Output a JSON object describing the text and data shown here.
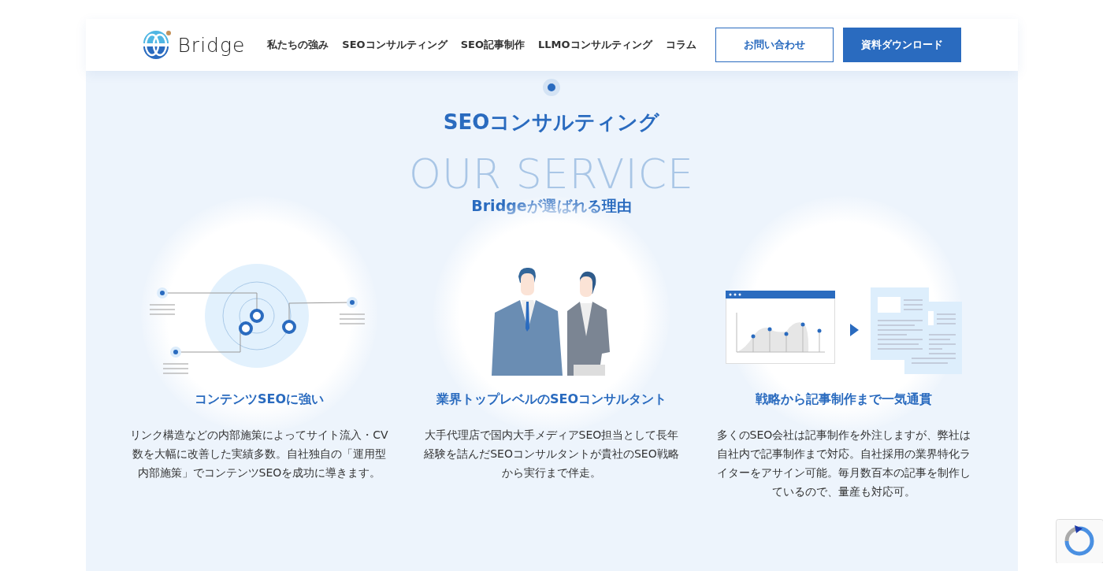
{
  "header": {
    "logo_text": "Bridge",
    "nav": [
      {
        "label": "私たちの強み"
      },
      {
        "label": "SEOコンサルティング"
      },
      {
        "label": "SEO記事制作"
      },
      {
        "label": "LLMOコンサルティング"
      },
      {
        "label": "コラム"
      }
    ],
    "buttons": [
      {
        "label": "お問い合わせ",
        "kind": "outline"
      },
      {
        "label": "資料ダウンロード",
        "kind": "filled"
      }
    ]
  },
  "section": {
    "title": "SEOコンサルティング",
    "background_text": "OUR SERVICE",
    "subtitle": "Bridgeが選ばれる理由",
    "features": [
      {
        "kind": "network",
        "title": "コンテンツSEOに強い",
        "description": "リンク構造などの内部施策によってサイト流入・CV数を大幅に改善した実績多数。自社独自の「運用型内部施策」でコンテンツSEOを成功に導きます。"
      },
      {
        "kind": "people",
        "title": "業界トップレベルのSEOコンサルタント",
        "description": "大手代理店で国内大手メディアSEO担当として長年経験を詰んだSEOコンサルタントが貴社のSEO戦略から実行まで伴走。"
      },
      {
        "kind": "analytics",
        "title": "戦略から記事制作まで一気通貫",
        "description": "多くのSEO会社は記事制作を外注しますが、弊社は自社内で記事制作まで対応。自社採用の業界特化ライターをアサイン可能。毎月数百本の記事を制作しているので、量産も対応可。"
      }
    ]
  }
}
